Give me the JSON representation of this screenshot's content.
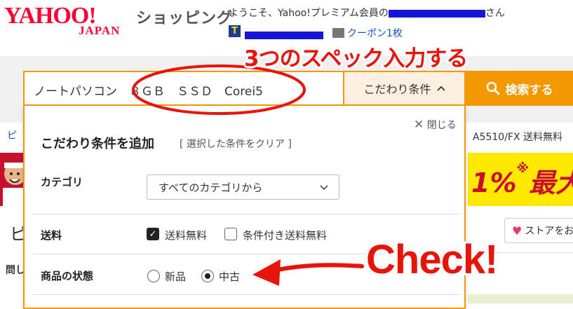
{
  "header": {
    "logo_yahoo": "YAHOO!",
    "logo_japan": "JAPAN",
    "service_name": "ショッピング",
    "welcome_prefix": "ようこそ、Yahoo!プレミアム会員の",
    "welcome_suffix": "さん",
    "tpoint_icon": "T",
    "coupon_label": "クーポン1枚"
  },
  "search": {
    "query": "ノートパソコン　８ＧＢ　ＳＳＤ　Corei5",
    "conditions_label": "こだわり条件",
    "search_button_label": "検索する"
  },
  "background": {
    "breadcrumb_text": "ピ",
    "right_title": "A5510/FX 送料無料",
    "banner_text": "1%",
    "banner_star": "※",
    "banner_suffix": "最大",
    "sidebar_heading": "ピ",
    "sidebar_sub": "問し",
    "store_button_label": "ストアをお"
  },
  "panel": {
    "close_label": "閉じる",
    "title": "こだわり条件を追加",
    "clear_label": "[ 選択した条件をクリア ]",
    "category": {
      "label": "カテゴリ",
      "selected": "すべてのカテゴリから"
    },
    "shipping": {
      "label": "送料",
      "options": [
        {
          "label": "送料無料",
          "checked": true
        },
        {
          "label": "条件付き送料無料",
          "checked": false
        }
      ]
    },
    "condition": {
      "label": "商品の状態",
      "options": [
        {
          "label": "新品",
          "selected": false
        },
        {
          "label": "中古",
          "selected": true
        }
      ]
    }
  },
  "annotations": {
    "spec_note": "3つのスペック入力する",
    "check_note": "Check!"
  },
  "colors": {
    "accent_orange": "#f39800",
    "annotation_red": "#e8140a",
    "brand_red": "#ff0033",
    "link_blue": "#1a50c8"
  }
}
